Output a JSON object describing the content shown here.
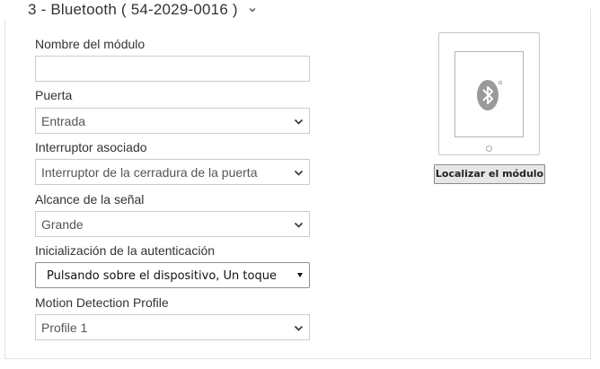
{
  "module": {
    "title": "3 - Bluetooth ( 54-2029-0016 )",
    "locate_button": "Localizar el módulo"
  },
  "fields": {
    "name": {
      "label": "Nombre del módulo",
      "value": ""
    },
    "door": {
      "label": "Puerta",
      "value": "Entrada"
    },
    "switch": {
      "label": "Interruptor asociado",
      "value": "Interruptor de la cerradura de la puerta"
    },
    "range": {
      "label": "Alcance de la señal",
      "value": "Grande"
    },
    "auth_init": {
      "label": "Inicialización de la autenticación",
      "value": "Pulsando sobre el dispositivo, Un toque"
    },
    "motion": {
      "label": "Motion Detection Profile",
      "value": "Profile 1"
    }
  }
}
